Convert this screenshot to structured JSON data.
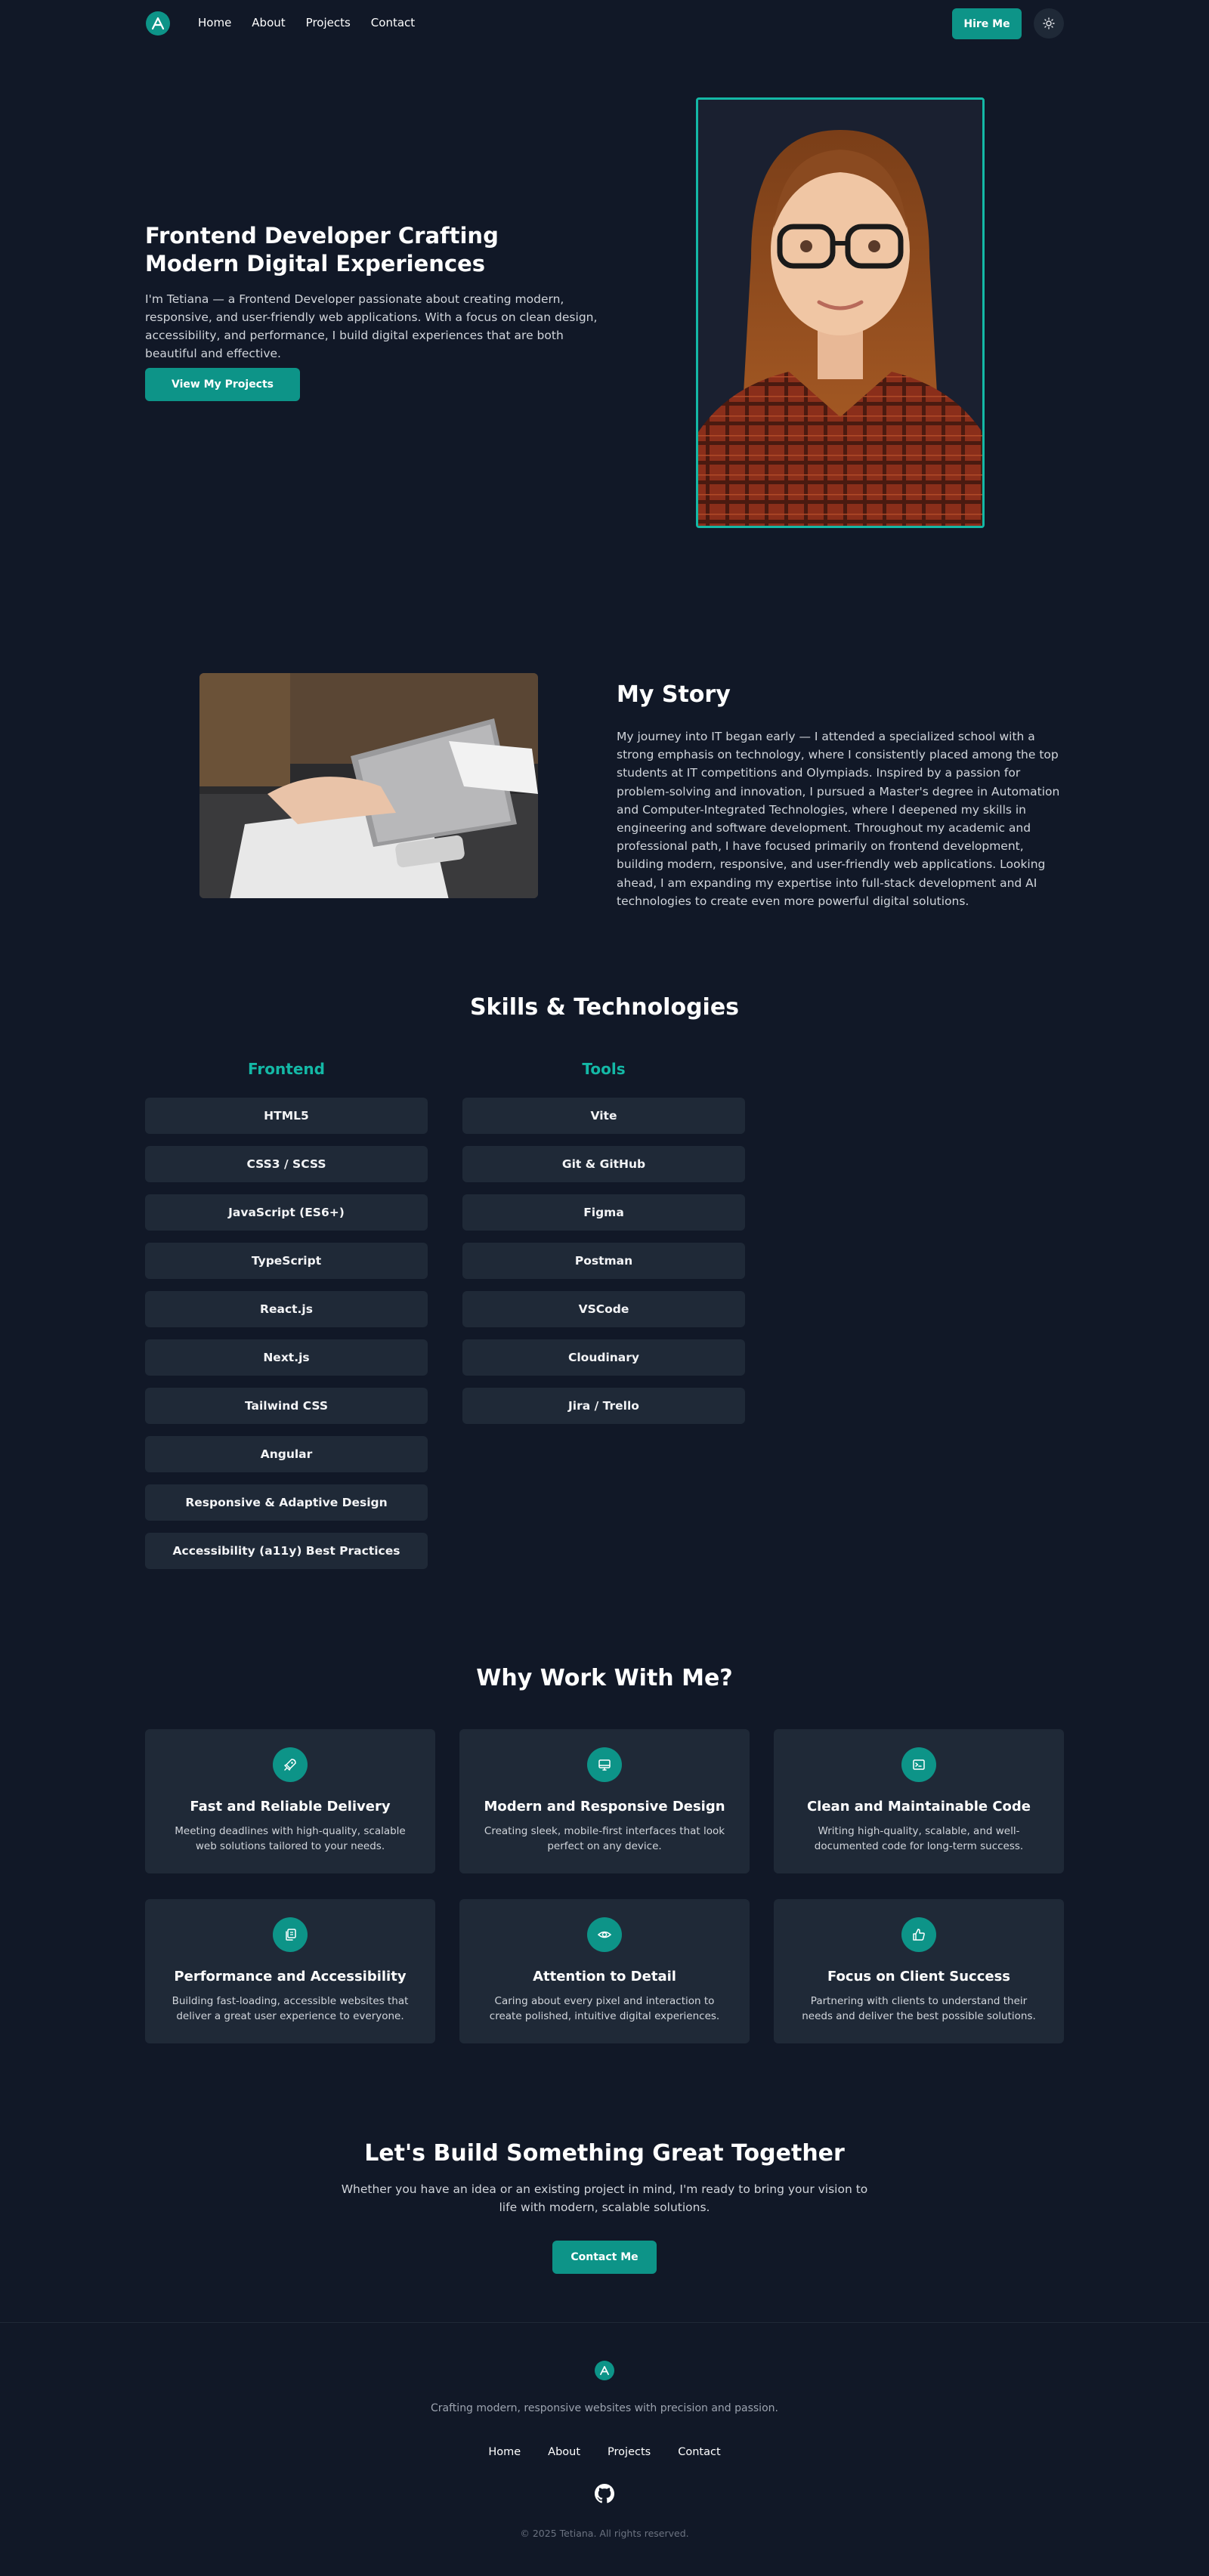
{
  "nav": {
    "links": [
      "Home",
      "About",
      "Projects",
      "Contact"
    ],
    "hire_label": "Hire Me"
  },
  "hero": {
    "title": "Frontend Developer Crafting Modern Digital Experiences",
    "text": "I'm Tetiana — a Frontend Developer passionate about creating modern, responsive, and user-friendly web applications. With a focus on clean design, accessibility, and performance, I build digital experiences that are both beautiful and effective.",
    "button": "View My Projects"
  },
  "story": {
    "title": "My Story",
    "text": "My journey into IT began early — I attended a specialized school with a strong emphasis on technology, where I consistently placed among the top students at IT competitions and Olympiads. Inspired by a passion for problem-solving and innovation, I pursued a Master's degree in Automation and Computer-Integrated Technologies, where I deepened my skills in engineering and software development. Throughout my academic and professional path, I have focused primarily on frontend development, building modern, responsive, and user-friendly web applications. Looking ahead, I am expanding my expertise into full-stack development and AI technologies to create even more powerful digital solutions."
  },
  "skills": {
    "title": "Skills & Technologies",
    "frontend_title": "Frontend",
    "frontend": [
      "HTML5",
      "CSS3 / SCSS",
      "JavaScript (ES6+)",
      "TypeScript",
      "React.js",
      "Next.js",
      "Tailwind CSS",
      "Angular",
      "Responsive & Adaptive Design",
      "Accessibility (a11y) Best Practices"
    ],
    "tools_title": "Tools",
    "tools": [
      "Vite",
      "Git & GitHub",
      "Figma",
      "Postman",
      "VSCode",
      "Cloudinary",
      "Jira / Trello"
    ]
  },
  "why": {
    "title": "Why Work With Me?",
    "cards": [
      {
        "icon": "rocket-icon",
        "title": "Fast and Reliable Delivery",
        "text": "Meeting deadlines with high-quality, scalable web solutions tailored to your needs."
      },
      {
        "icon": "monitor-icon",
        "title": "Modern and Responsive Design",
        "text": "Creating sleek, mobile-first interfaces that look perfect on any device."
      },
      {
        "icon": "terminal-icon",
        "title": "Clean and Maintainable Code",
        "text": "Writing high-quality, scalable, and well-documented code for long-term success."
      },
      {
        "icon": "copy-icon",
        "title": "Performance and Accessibility",
        "text": "Building fast-loading, accessible websites that deliver a great user experience to everyone."
      },
      {
        "icon": "eye-icon",
        "title": "Attention to Detail",
        "text": "Caring about every pixel and interaction to create polished, intuitive digital experiences."
      },
      {
        "icon": "thumbs-up-icon",
        "title": "Focus on Client Success",
        "text": "Partnering with clients to understand their needs and deliver the best possible solutions."
      }
    ]
  },
  "cta": {
    "title": "Let's Build Something Great Together",
    "text": "Whether you have an idea or an existing project in mind, I'm ready to bring your vision to life with modern, scalable solutions.",
    "button": "Contact Me"
  },
  "footer": {
    "tagline": "Crafting modern, responsive websites with precision and passion.",
    "links": [
      "Home",
      "About",
      "Projects",
      "Contact"
    ],
    "copyright": "© 2025 Tetiana. All rights reserved."
  },
  "colors": {
    "background": "#111827",
    "card": "#1f2937",
    "accent": "#0d9488",
    "accent_light": "#14b8a6"
  }
}
